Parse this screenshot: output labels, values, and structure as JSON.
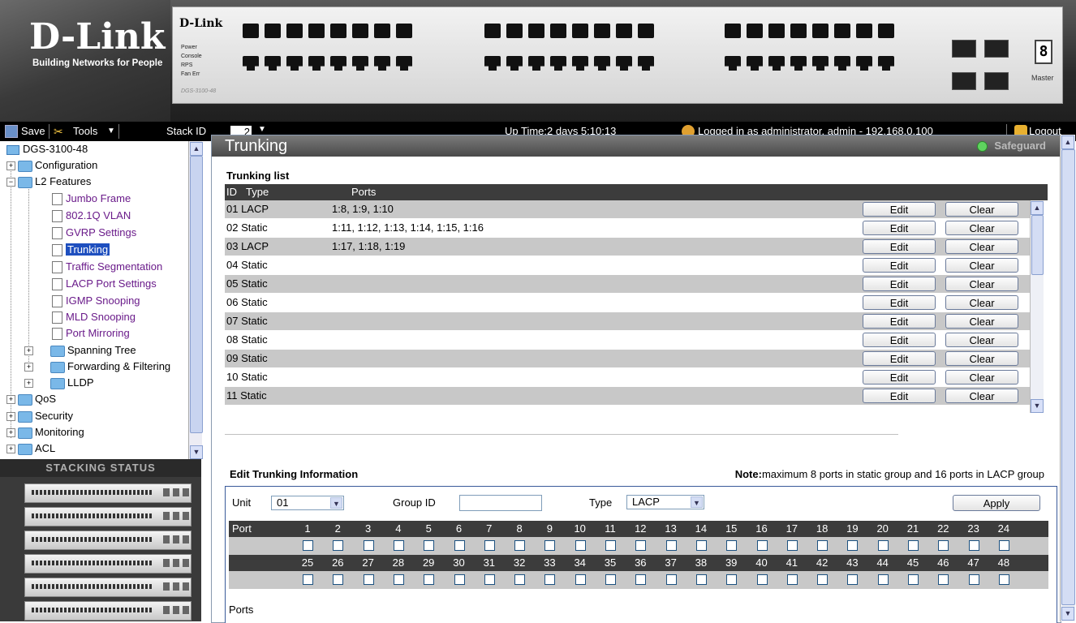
{
  "header": {
    "logo": "D-Link",
    "tagline": "Building Networks for People",
    "panel_brand": "D-Link",
    "panel_leds": [
      "Power",
      "Console",
      "RPS",
      "Fan Err"
    ],
    "model": "DGS-3100-48",
    "segment_display": "8",
    "master_label": "Master"
  },
  "toolbar": {
    "save_label": "Save",
    "tools_label": "Tools",
    "stack_id_label": "Stack ID",
    "stack_id_value": "2",
    "status_text": "Up Time:2 days 5:10:13",
    "login_text": "Logged in as administrator, admin - 192.168.0.100",
    "logout_label": "Logout"
  },
  "tree": {
    "root": "DGS-3100-48",
    "configuration": "Configuration",
    "l2_features": "L2 Features",
    "leaves": [
      "Jumbo Frame",
      "802.1Q VLAN",
      "GVRP Settings",
      "Trunking",
      "Traffic Segmentation",
      "LACP Port Settings",
      "IGMP Snooping",
      "MLD Snooping",
      "Port Mirroring"
    ],
    "sub_folders": [
      "Spanning Tree",
      "Forwarding & Filtering",
      "LLDP"
    ],
    "top_folders": [
      "QoS",
      "Security",
      "Monitoring",
      "ACL"
    ]
  },
  "stacking_status": {
    "title": "Stacking Status",
    "unit_count": 6
  },
  "main": {
    "title": "Trunking",
    "safeguard": "Safeguard",
    "list_title": "Trunking list",
    "columns": {
      "id": "ID",
      "type": "Type",
      "ports": "Ports"
    },
    "edit_label": "Edit",
    "clear_label": "Clear",
    "rows": [
      {
        "id_type": "01 LACP",
        "ports": "1:8, 1:9, 1:10"
      },
      {
        "id_type": "02 Static",
        "ports": "1:11, 1:12, 1:13, 1:14, 1:15, 1:16"
      },
      {
        "id_type": "03 LACP",
        "ports": "1:17, 1:18, 1:19"
      },
      {
        "id_type": "04 Static",
        "ports": ""
      },
      {
        "id_type": "05 Static",
        "ports": ""
      },
      {
        "id_type": "06 Static",
        "ports": ""
      },
      {
        "id_type": "07 Static",
        "ports": ""
      },
      {
        "id_type": "08 Static",
        "ports": ""
      },
      {
        "id_type": "09 Static",
        "ports": ""
      },
      {
        "id_type": "10 Static",
        "ports": ""
      },
      {
        "id_type": "11 Static",
        "ports": ""
      }
    ]
  },
  "edit": {
    "title": "Edit Trunking Information",
    "note_bold": "Note:",
    "note_text": "maximum 8 ports in static group and 16 ports in LACP group",
    "unit_label": "Unit",
    "unit_value": "01",
    "group_id_label": "Group ID",
    "group_id_value": "",
    "type_label": "Type",
    "type_value": "LACP",
    "apply_label": "Apply",
    "port_label": "Port",
    "ports_row1": [
      "1",
      "2",
      "3",
      "4",
      "5",
      "6",
      "7",
      "8",
      "9",
      "10",
      "11",
      "12",
      "13",
      "14",
      "15",
      "16",
      "17",
      "18",
      "19",
      "20",
      "21",
      "22",
      "23",
      "24"
    ],
    "ports_row2": [
      "25",
      "26",
      "27",
      "28",
      "29",
      "30",
      "31",
      "32",
      "33",
      "34",
      "35",
      "36",
      "37",
      "38",
      "39",
      "40",
      "41",
      "42",
      "43",
      "44",
      "45",
      "46",
      "47",
      "48"
    ],
    "ports_footer": "Ports"
  },
  "colors": {
    "selection": "#1e4fbf",
    "row_alt": "#c8c8c8",
    "header_band": "#3c3c3c",
    "leaf_link": "#6a1b8a",
    "safeguard_led": "#5fd35f"
  }
}
